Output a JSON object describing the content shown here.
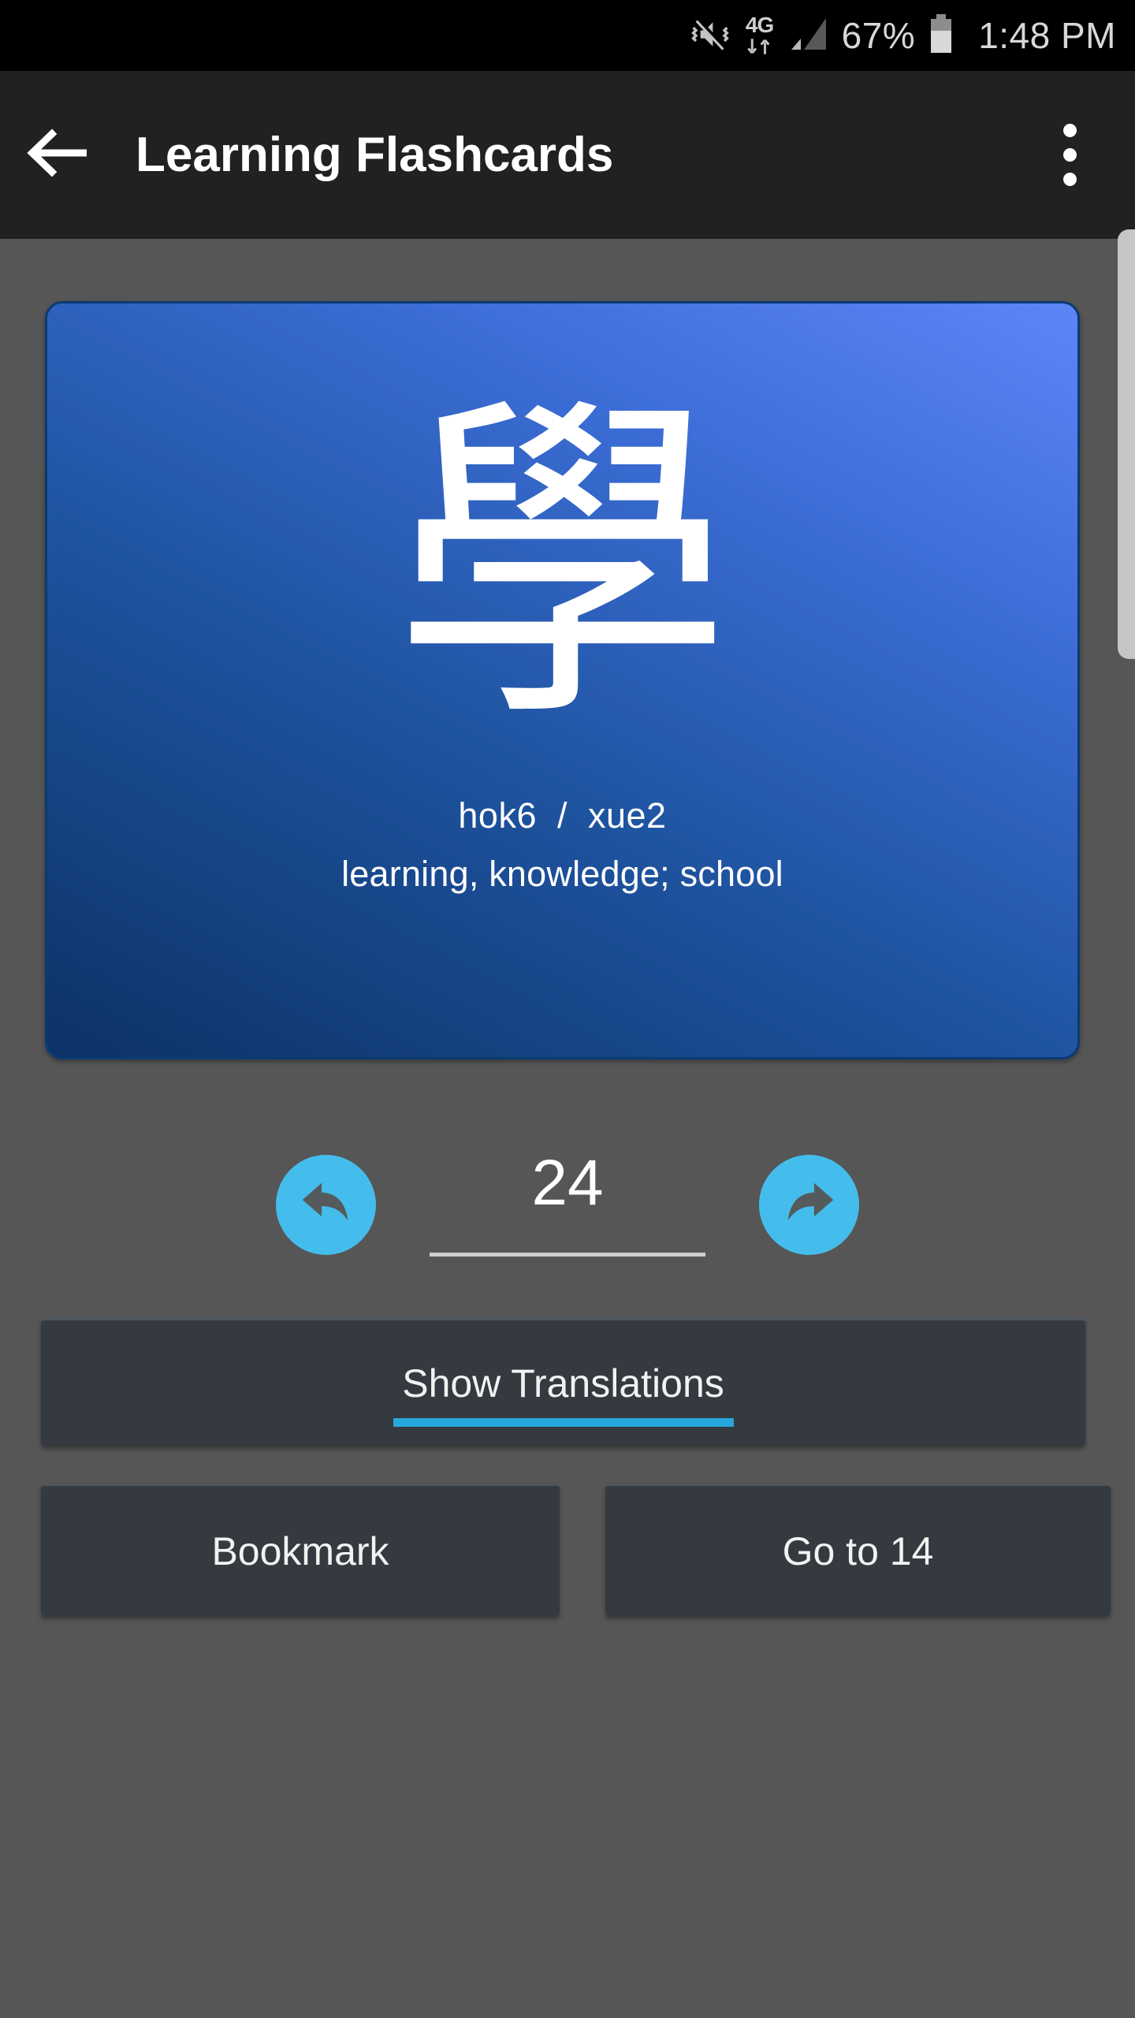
{
  "status_bar": {
    "icons": [
      "vibrate-mute-icon",
      "network-4g-icon",
      "signal-bars-icon",
      "battery-icon"
    ],
    "network_label": "4G",
    "battery_percent": "67%",
    "time": "1:48 PM"
  },
  "app_bar": {
    "back_icon": "arrow-left-icon",
    "title": "Learning Flashcards",
    "overflow_icon": "more-vertical-icon"
  },
  "flashcard": {
    "character": "學",
    "readings": "hok6  /  xue2",
    "meaning": "learning, knowledge; school"
  },
  "navigation": {
    "previous_icon": "reply-arrow-icon",
    "next_icon": "forward-arrow-icon",
    "index_value": "24",
    "index_placeholder": "24"
  },
  "actions": {
    "show_translations_label": "Show Translations",
    "bookmark_label": "Bookmark",
    "goto_label": "Go to 14"
  },
  "colors": {
    "background": "#565656",
    "app_bar": "#212121",
    "status_bar": "#000000",
    "card_gradient_start": "#0c3266",
    "card_gradient_end": "#5e85f7",
    "card_border": "#0b3a72",
    "accent_blue": "#27a8dd",
    "circle_button": "#44bdec",
    "button_surface": "#343a40",
    "scrollbar": "#c6c6c6"
  }
}
